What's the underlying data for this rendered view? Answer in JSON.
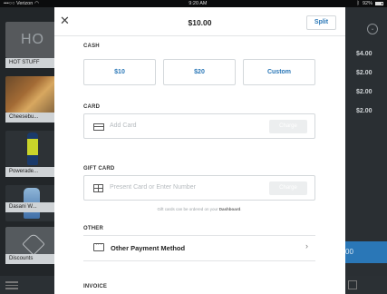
{
  "status_bar": {
    "carrier": "•••○○ Verizon",
    "time": "9:20 AM",
    "battery": "92%"
  },
  "background": {
    "tiles": [
      {
        "image_text": "HO",
        "label": "HOT STUFF"
      },
      {
        "label": "Cheesebu..."
      },
      {
        "label": "Powerade..."
      },
      {
        "label": "Dasani W..."
      },
      {
        "label": "Discounts"
      }
    ],
    "prices": [
      "$4.00",
      "$2.00",
      "$2.00",
      "$2.00"
    ],
    "charge_button": "00"
  },
  "modal": {
    "total": "$10.00",
    "split_label": "Split",
    "cash": {
      "title": "CASH",
      "options": [
        "$10",
        "$20",
        "Custom"
      ]
    },
    "card": {
      "title": "CARD",
      "placeholder": "Add Card",
      "charge_label": "Charge"
    },
    "gift_card": {
      "title": "GIFT CARD",
      "placeholder": "Present Card or Enter Number",
      "charge_label": "Charge",
      "note": "Gift cards can be ordered on your",
      "note_link": "Dashboard",
      "note_end": "."
    },
    "other": {
      "title": "OTHER",
      "label": "Other Payment Method"
    },
    "invoice": {
      "title": "INVOICE"
    }
  },
  "colors": {
    "accent": "#2a77b7",
    "background_dark": "#1f2326"
  }
}
